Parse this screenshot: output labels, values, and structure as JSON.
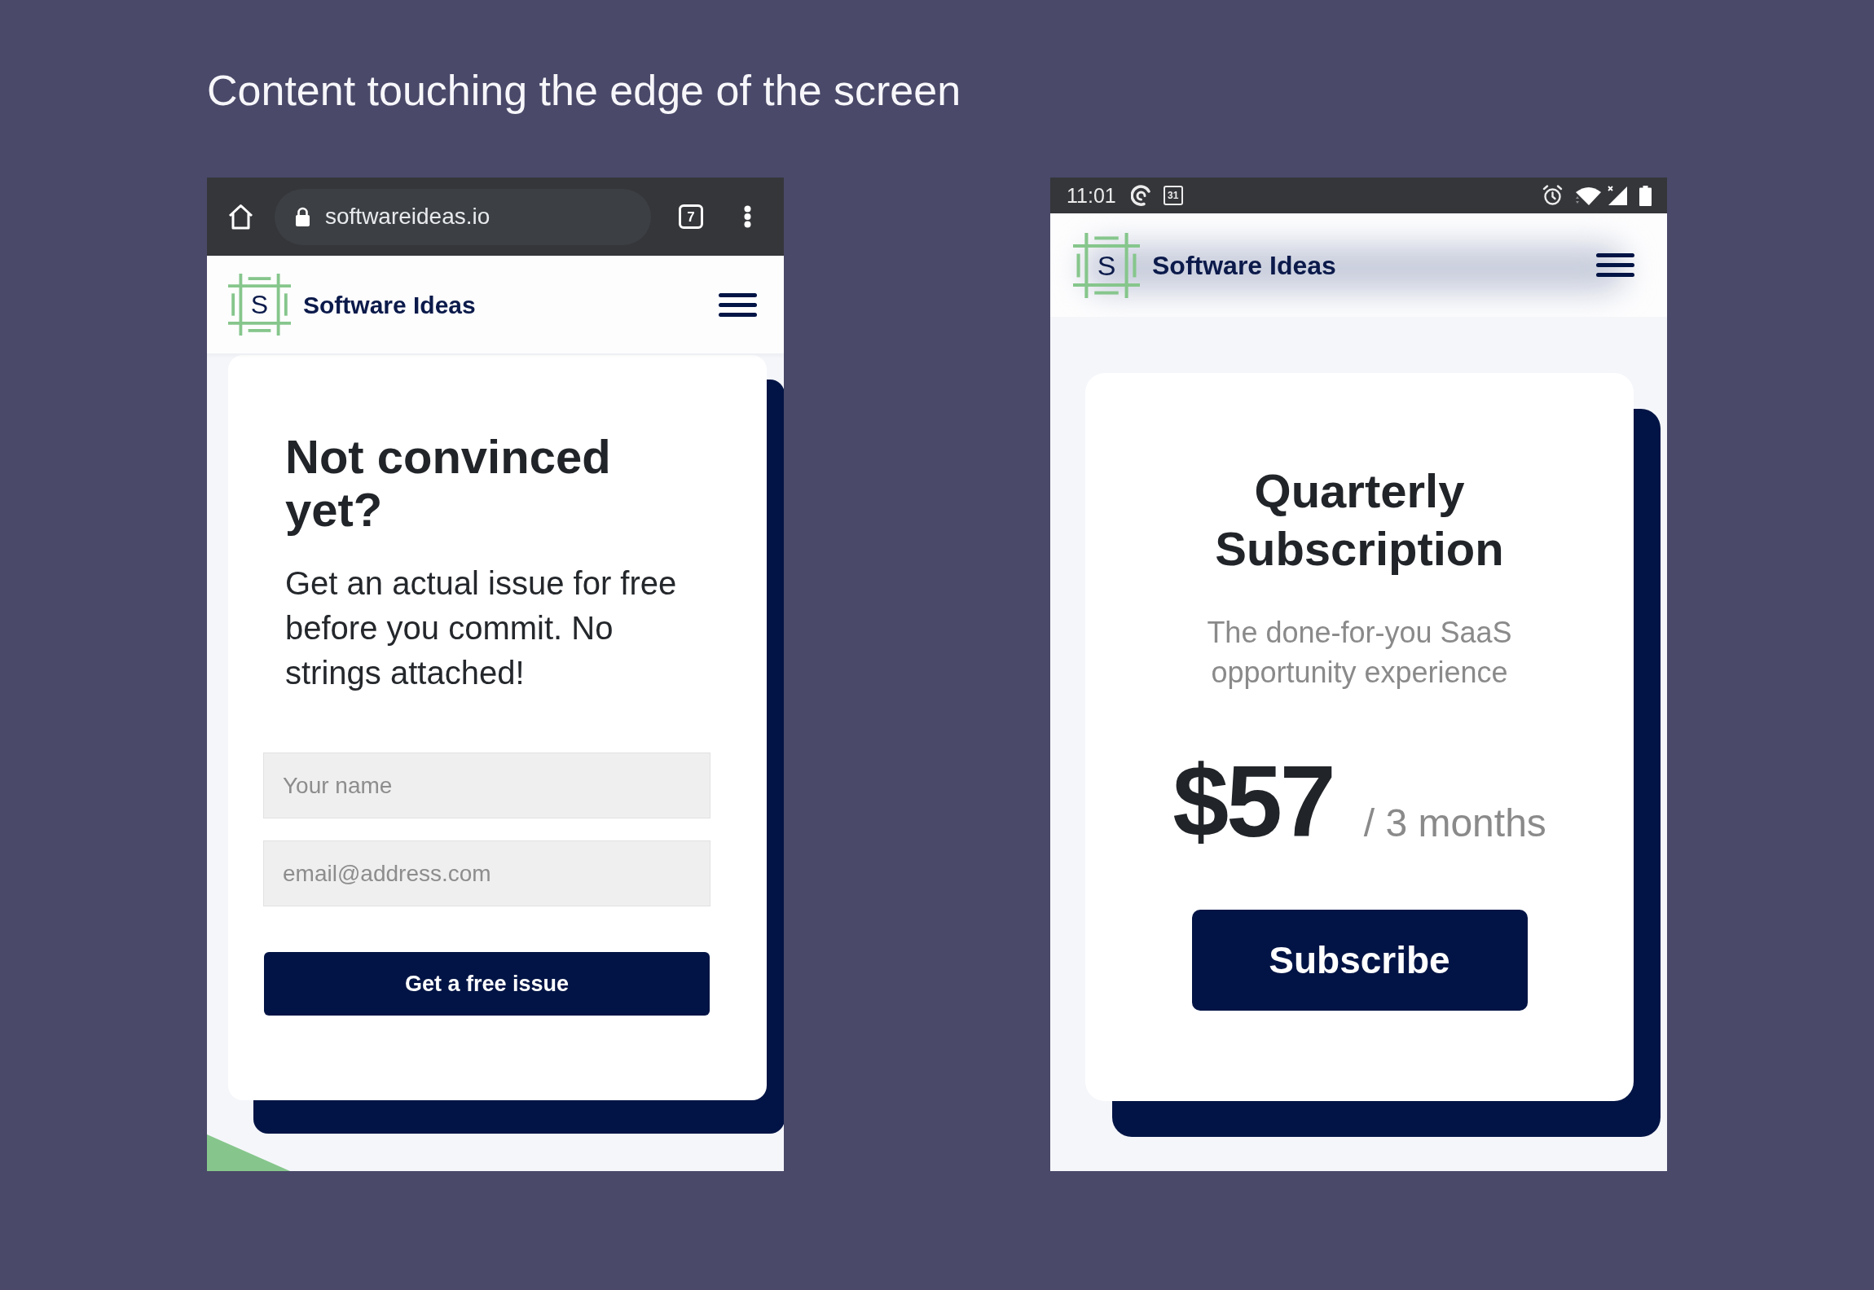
{
  "title": "Content touching the edge of the screen",
  "screens": [
    {
      "kind": "browser",
      "browser_bar": {
        "url": "softwareideas.io",
        "tab_count": "7"
      },
      "header": {
        "logo_letter": "S",
        "brand": "Software Ideas"
      },
      "card": {
        "kind": "lead_form",
        "heading": "Not convinced yet?",
        "text": "Get an actual issue for free before you commit. No strings attached!",
        "fields": [
          {
            "placeholder": "Your name"
          },
          {
            "placeholder": "email@address.com"
          }
        ],
        "button": "Get a free issue"
      }
    },
    {
      "kind": "app",
      "status_bar": {
        "time": "11:01",
        "calendar_day": "31"
      },
      "header": {
        "logo_letter": "S",
        "brand": "Software Ideas"
      },
      "card": {
        "kind": "pricing",
        "heading": "Quarterly Subscription",
        "subtitle": "The done-for-you SaaS opportunity experience",
        "price": "$57",
        "period": "/ 3 months",
        "button": "Subscribe"
      }
    }
  ]
}
